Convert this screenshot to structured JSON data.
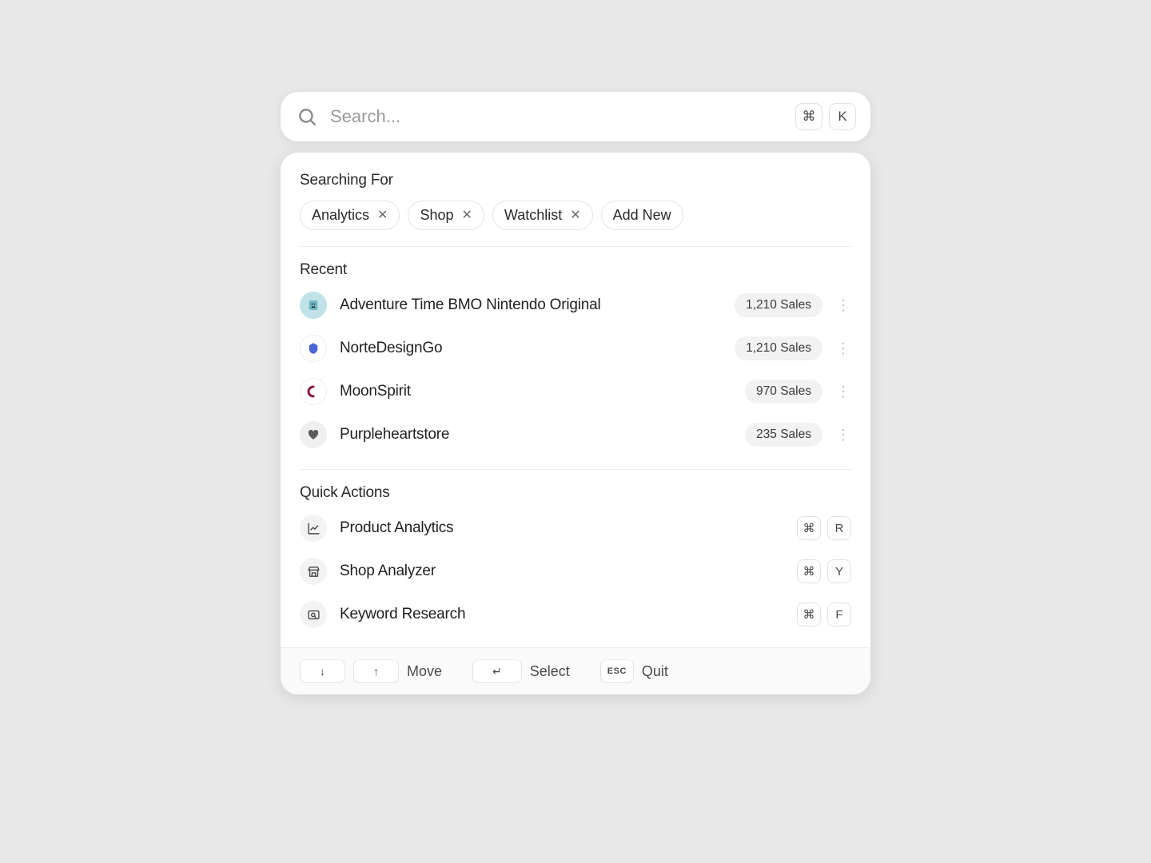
{
  "search": {
    "placeholder": "Search...",
    "shortcut": {
      "mod": "⌘",
      "key": "K"
    }
  },
  "sections": {
    "searching_for": "Searching For",
    "recent": "Recent",
    "quick_actions": "Quick Actions"
  },
  "filters": [
    {
      "label": "Analytics"
    },
    {
      "label": "Shop"
    },
    {
      "label": "Watchlist"
    }
  ],
  "filters_add_label": "Add New",
  "recent": [
    {
      "title": "Adventure Time BMO Nintendo Original",
      "sales": "1,210 Sales",
      "avatar_bg": "#bfe3e8"
    },
    {
      "title": "NorteDesignGo",
      "sales": "1,210 Sales",
      "avatar_bg": "#ffffff"
    },
    {
      "title": "MoonSpirit",
      "sales": "970 Sales",
      "avatar_bg": "#ffffff"
    },
    {
      "title": "Purpleheartstore",
      "sales": "235 Sales",
      "avatar_bg": "#efefef"
    }
  ],
  "quick_actions": [
    {
      "title": "Product Analytics",
      "mod": "⌘",
      "key": "R",
      "icon": "chart"
    },
    {
      "title": "Shop Analyzer",
      "mod": "⌘",
      "key": "Y",
      "icon": "storefront"
    },
    {
      "title": "Keyword Research",
      "mod": "⌘",
      "key": "F",
      "icon": "search-box"
    }
  ],
  "footer": {
    "move": "Move",
    "select": "Select",
    "quit": "Quit",
    "esc": "ESC"
  }
}
